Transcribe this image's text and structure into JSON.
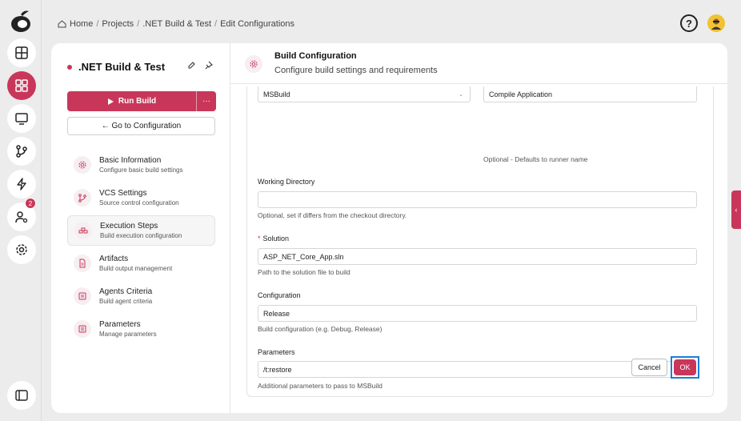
{
  "breadcrumb": {
    "items": [
      "Home",
      "Projects",
      ".NET Build & Test",
      "Edit Configurations"
    ],
    "separator": "/"
  },
  "rail": {
    "badge_count": "2"
  },
  "project": {
    "title": ".NET Build & Test",
    "run_build_label": "Run Build",
    "more_label": "···",
    "goto_config_label": "← Go to Configuration"
  },
  "nav": [
    {
      "title": "Basic Information",
      "sub": "Configure basic build settings"
    },
    {
      "title": "VCS Settings",
      "sub": "Source control configuration"
    },
    {
      "title": "Execution Steps",
      "sub": "Build execution configuration"
    },
    {
      "title": "Artifacts",
      "sub": "Build output management"
    },
    {
      "title": "Agents Criteria",
      "sub": "Build agent criteria"
    },
    {
      "title": "Parameters",
      "sub": "Manage parameters"
    }
  ],
  "header": {
    "title": "Build Configuration",
    "subtitle": "Configure build settings and requirements"
  },
  "form": {
    "runner_type_value": "MSBuild",
    "step_name_value": "Compile Application",
    "step_name_hint": "Optional - Defaults to runner name",
    "working_dir_label": "Working Directory",
    "working_dir_value": "",
    "working_dir_hint": "Optional, set if differs from the checkout directory.",
    "solution_label": "Solution",
    "solution_required": "*",
    "solution_value": "ASP_NET_Core_App.sln",
    "solution_hint": "Path to the solution file to build",
    "configuration_label": "Configuration",
    "configuration_value": "Release",
    "configuration_hint": "Build configuration (e.g. Debug, Release)",
    "parameters_label": "Parameters",
    "parameters_value": "/t:restore",
    "parameters_hint": "Additional parameters to pass to MSBuild",
    "cancel_label": "Cancel",
    "ok_label": "OK"
  },
  "side_tab": {
    "label": "‹"
  },
  "colors": {
    "accent": "#c8375a",
    "focus": "#1e7cd8"
  }
}
